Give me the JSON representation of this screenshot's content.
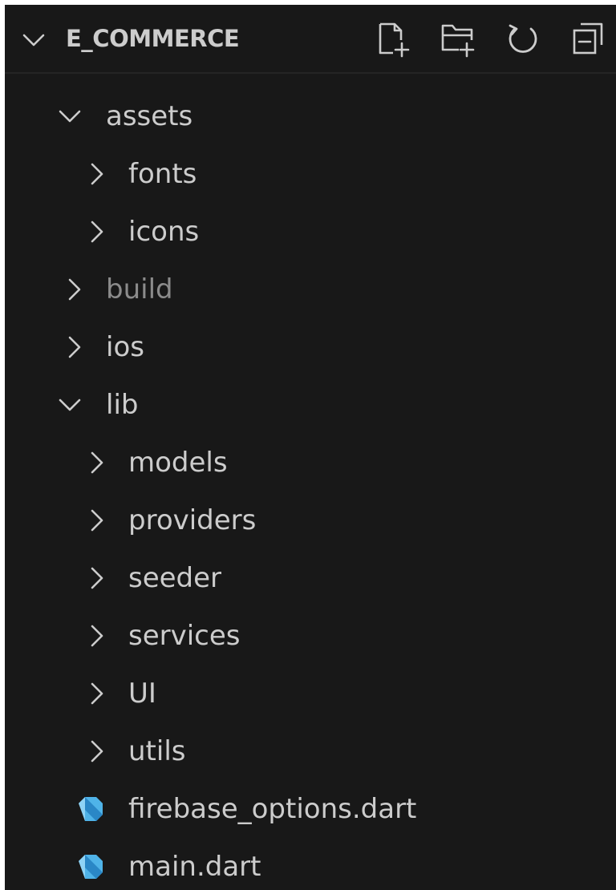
{
  "explorer": {
    "title": "E_COMMERCE",
    "actions": [
      {
        "name": "new-file-icon"
      },
      {
        "name": "new-folder-icon"
      },
      {
        "name": "refresh-icon"
      },
      {
        "name": "collapse-all-icon"
      }
    ],
    "tree": [
      {
        "label": "assets",
        "kind": "folder",
        "expanded": true,
        "depth": 1
      },
      {
        "label": "fonts",
        "kind": "folder",
        "expanded": false,
        "depth": 2
      },
      {
        "label": "icons",
        "kind": "folder",
        "expanded": false,
        "depth": 2
      },
      {
        "label": "build",
        "kind": "folder",
        "expanded": false,
        "depth": 1,
        "dimmed": true
      },
      {
        "label": "ios",
        "kind": "folder",
        "expanded": false,
        "depth": 1
      },
      {
        "label": "lib",
        "kind": "folder",
        "expanded": true,
        "depth": 1
      },
      {
        "label": "models",
        "kind": "folder",
        "expanded": false,
        "depth": 2
      },
      {
        "label": "providers",
        "kind": "folder",
        "expanded": false,
        "depth": 2
      },
      {
        "label": "seeder",
        "kind": "folder",
        "expanded": false,
        "depth": 2
      },
      {
        "label": "services",
        "kind": "folder",
        "expanded": false,
        "depth": 2
      },
      {
        "label": "UI",
        "kind": "folder",
        "expanded": false,
        "depth": 2
      },
      {
        "label": "utils",
        "kind": "folder",
        "expanded": false,
        "depth": 2
      },
      {
        "label": "firebase_options.dart",
        "kind": "dart-file",
        "depth": 2
      },
      {
        "label": "main.dart",
        "kind": "dart-file",
        "depth": 2
      }
    ]
  },
  "colors": {
    "background": "#181818",
    "text": "#cccccc",
    "dimmed_text": "#8b8b8b",
    "dart_icon": "#4fb3e8"
  }
}
